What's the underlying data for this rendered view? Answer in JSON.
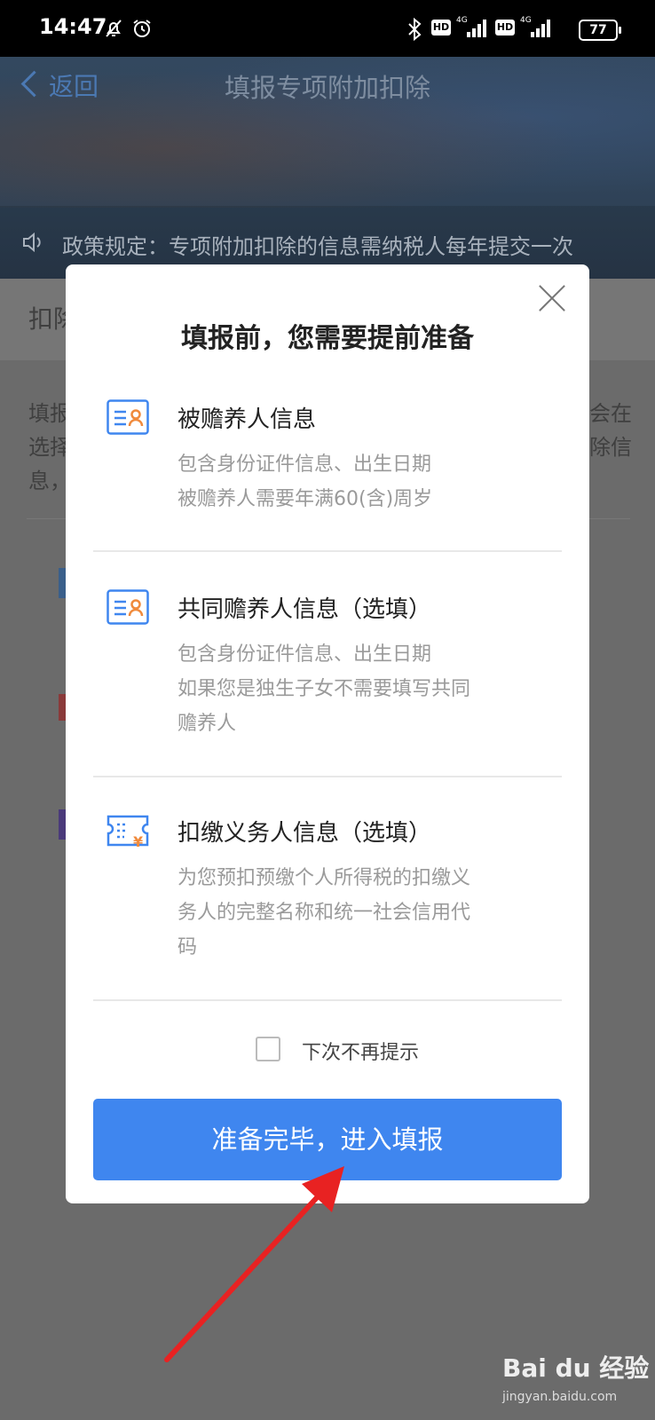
{
  "status_bar": {
    "time": "14:47",
    "left_icons": [
      "bell-off-icon",
      "alarm-icon"
    ],
    "right_icons": [
      "bluetooth-icon",
      "hd-icon",
      "4g-signal-icon",
      "hd-icon",
      "4g-signal-icon"
    ],
    "battery": "77"
  },
  "header": {
    "back_label": "返回",
    "title": "填报专项附加扣除",
    "notice": "政策规定：专项附加扣除的信息需纳税人每年提交一次"
  },
  "background": {
    "section_label": "扣除",
    "intro_lines": [
      "填报",
      "选择",
      "息，"
    ],
    "right_fragments": [
      "会在",
      "除信"
    ]
  },
  "modal": {
    "title": "填报前，您需要提前准备",
    "items": [
      {
        "icon": "id-card-person-icon",
        "title": "被赡养人信息",
        "desc": [
          "包含身份证件信息、出生日期",
          "被赡养人需要年满60(含)周岁"
        ]
      },
      {
        "icon": "id-card-person-icon",
        "title": "共同赡养人信息（选填）",
        "desc": [
          "包含身份证件信息、出生日期",
          "如果您是独生子女不需要填写共同",
          "赡养人"
        ]
      },
      {
        "icon": "ticket-yuan-icon",
        "title": "扣缴义务人信息（选填）",
        "desc": [
          "为您预扣预缴个人所得税的扣缴义",
          "务人的完整名称和统一社会信用代",
          "码"
        ]
      }
    ],
    "checkbox_label": "下次不再提示",
    "checkbox_checked": false,
    "primary_button": "准备完毕，进入填报"
  },
  "watermark": {
    "brand": "Bai du 经验",
    "url": "jingyan.baidu.com"
  },
  "colors": {
    "primary": "#3f86ef",
    "icon_blue": "#3f86ef",
    "icon_orange": "#f08a3c",
    "annotation_arrow": "#e82222"
  }
}
